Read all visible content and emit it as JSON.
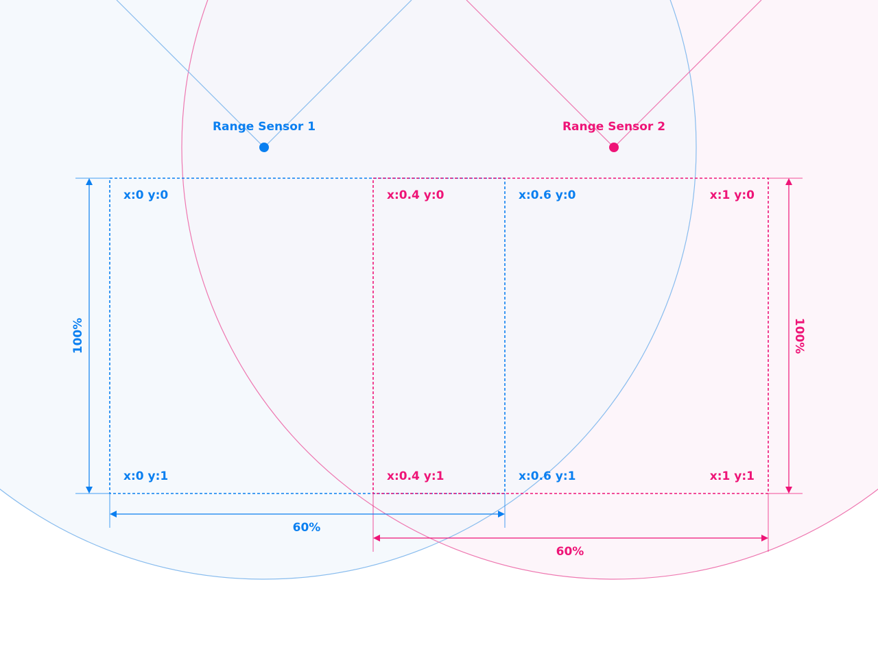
{
  "colors": {
    "sensor1": "#0a7ff0",
    "sensor2": "#ee1477",
    "sensor1_fill": "#f5f9fd",
    "sensor2_fill": "#fdf5fa",
    "overlap_fill": "#f6f6fb",
    "sensor1_outline": "#88bcee",
    "sensor2_outline": "#ee77b0"
  },
  "sensors": [
    {
      "name": "Range Sensor 1"
    },
    {
      "name": "Range Sensor 2"
    }
  ],
  "sensor1_zone": {
    "corners": {
      "top_left": "x:0 y:0",
      "top_right": "x:0.6 y:0",
      "bottom_left": "x:0 y:1",
      "bottom_right": "x:0.6 y:1"
    },
    "width_label": "60%",
    "height_label": "100%"
  },
  "sensor2_zone": {
    "corners": {
      "top_left": "x:0.4 y:0",
      "top_right": "x:1 y:0",
      "bottom_left": "x:0.4 y:1",
      "bottom_right": "x:1 y:1"
    },
    "width_label": "60%",
    "height_label": "100%"
  }
}
